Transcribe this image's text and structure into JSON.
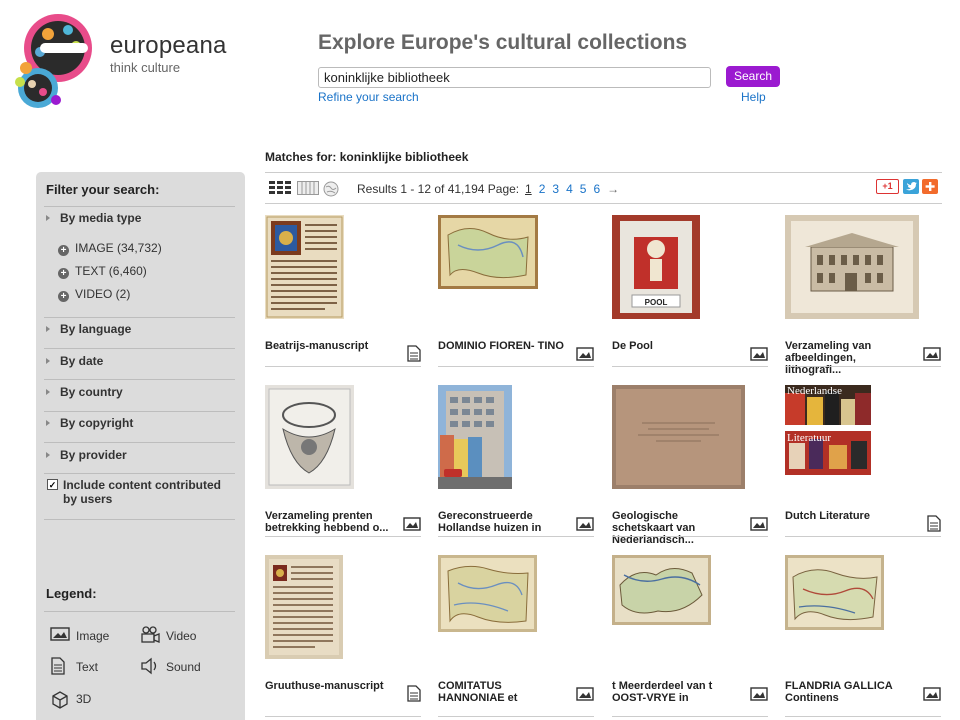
{
  "brand": {
    "name": "europeana",
    "tagline": "think culture"
  },
  "header": {
    "title": "Explore Europe's cultural collections",
    "search_value": "koninklijke bibliotheek",
    "search_button": "Search",
    "refine_link": "Refine your search",
    "help_link": "Help"
  },
  "matches": {
    "label": "Matches for:",
    "query": "koninklijke bibliotheek"
  },
  "sidebar": {
    "title": "Filter your search:",
    "media_type": "By media type",
    "media_options": [
      "IMAGE (34,732)",
      "TEXT (6,460)",
      "VIDEO (2)"
    ],
    "filters": [
      "By language",
      "By date",
      "By country",
      "By copyright",
      "By provider"
    ],
    "user_content_label": "Include content contributed by users",
    "user_content_checked": true
  },
  "legend": {
    "title": "Legend:",
    "items": [
      "Image",
      "Video",
      "Text",
      "Sound",
      "3D"
    ]
  },
  "results": {
    "summary": "Results 1 - 12 of 41,194",
    "page_label": "Page:",
    "pages": [
      "1",
      "2",
      "3",
      "4",
      "5",
      "6"
    ],
    "current_page": "1",
    "next_arrow": "→",
    "share": {
      "gplus": "+1"
    }
  },
  "items": [
    {
      "title": "Beatrijs-manuscript",
      "type": "text"
    },
    {
      "title": "DOMINIO FIOREN- TINO",
      "type": "image"
    },
    {
      "title": "De Pool",
      "type": "image"
    },
    {
      "title": "Verzameling van afbeeldingen, lithografi...",
      "type": "image"
    },
    {
      "title": "Verzameling prenten betrekking hebbend o...",
      "type": "image"
    },
    {
      "title": "Gereconstrueerde Hollandse huizen in",
      "type": "image"
    },
    {
      "title": "Geologische schetskaart van Nederlandsch...",
      "type": "image"
    },
    {
      "title": "Dutch Literature",
      "type": "text"
    },
    {
      "title": "Gruuthuse-manuscript",
      "type": "text"
    },
    {
      "title": "COMITATUS HANNONIAE et",
      "type": "image"
    },
    {
      "title": "t Meerderdeel van t OOST-VRYE in",
      "type": "image"
    },
    {
      "title": "FLANDRIA GALLICA Continens",
      "type": "image"
    }
  ],
  "thumb_text": {
    "nederlandse": "Nederlandse",
    "literatuur": "Literatuur",
    "pool_sign": "POOL"
  },
  "colors": {
    "accent": "#9b1ad0",
    "link": "#1a73c8",
    "sidebar": "#dcdcdc"
  }
}
